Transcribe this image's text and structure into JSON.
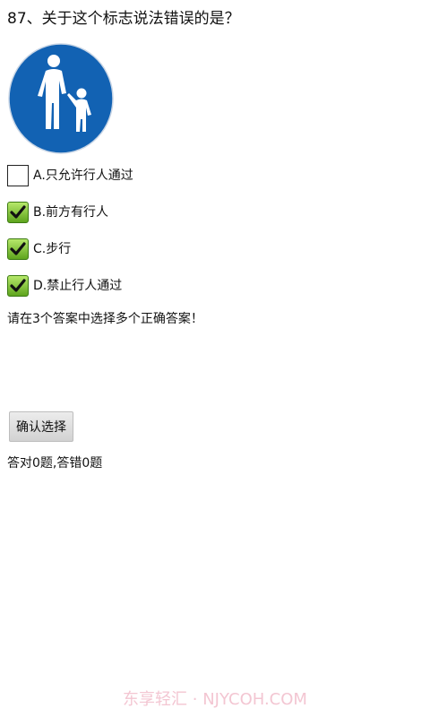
{
  "question": {
    "text": "87、关于这个标志说法错误的是？"
  },
  "sign": {
    "icon": "pedestrian-sign-icon",
    "background_color": "#1262b3",
    "border_color": "#ffffff"
  },
  "options": [
    {
      "label": "A.只允许行人通过",
      "checked": false
    },
    {
      "label": "B.前方有行人",
      "checked": true
    },
    {
      "label": "C.步行",
      "checked": true
    },
    {
      "label": "D.禁止行人通过",
      "checked": true
    }
  ],
  "hint": {
    "text": "请在3个答案中选择多个正确答案！"
  },
  "confirm_button": {
    "label": "确认选择"
  },
  "score": {
    "text": "答对0题,答错0题"
  },
  "watermark": {
    "text": "东享轻汇 · NJYCOH.COM"
  },
  "colors": {
    "checkbox_checked_top": "#b6e86a",
    "checkbox_checked_bottom": "#5ea41d",
    "watermark": "#f3c6d2"
  }
}
